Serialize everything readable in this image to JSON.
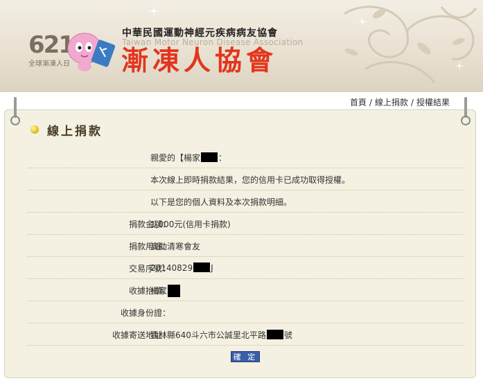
{
  "header": {
    "badge_number": "621",
    "badge_subtitle": "全球漸凍人日",
    "org_name_cn": "中華民國運動神經元疾病病友協會",
    "org_name_en": "Taiwan Motor Neuron Disease Association",
    "org_short_name": "漸凍人協會"
  },
  "breadcrumb": {
    "items": [
      "首頁",
      "線上捐款",
      "授權結果"
    ],
    "separator": "/"
  },
  "section": {
    "title": "線上捐款"
  },
  "greeting": {
    "prefix": "親愛的【楊家",
    "suffix": "："
  },
  "messages": {
    "result": "本次線上即時捐款結果，您的信用卡已成功取得授權。",
    "detail": "以下是您的個人資料及本次捐款明細。"
  },
  "fields": [
    {
      "label": "捐款金額：",
      "value": "1,000元(信用卡捐款)"
    },
    {
      "label": "捐款用途：",
      "value": "濟助清寒會友"
    },
    {
      "label": "交易序號：",
      "value_prefix": "20140829",
      "value_suffix": "J"
    },
    {
      "label": "收據抬頭：",
      "value_prefix": "楊家",
      "value_suffix": ""
    },
    {
      "label": "收據身份證：",
      "value": ""
    },
    {
      "label": "收據寄送地址：",
      "value_prefix": "雲林縣640斗六市公誠里北平路",
      "value_suffix": "號"
    }
  ],
  "actions": {
    "confirm_label": "確 定"
  },
  "colors": {
    "brand_red": "#e3351e",
    "card_bg": "#f4f1e2",
    "button_blue": "#3a5ea8"
  }
}
